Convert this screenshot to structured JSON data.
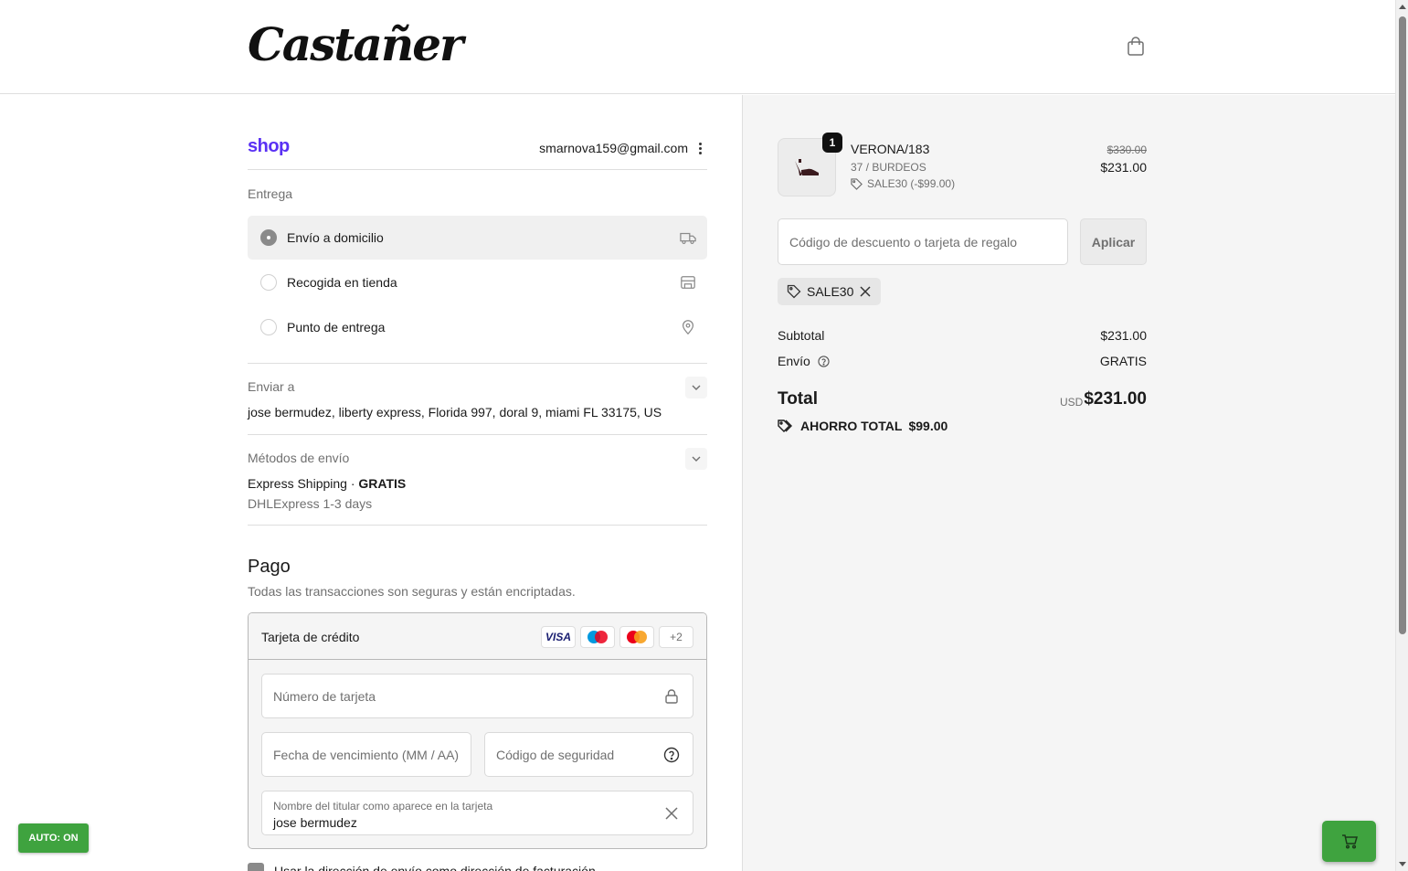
{
  "header": {
    "logo_text": "Castañer",
    "cart_icon": "shopping-bag-icon"
  },
  "account": {
    "shop_logo": "shop",
    "email": "smarnova159@gmail.com",
    "menu_icon": "kebab-icon"
  },
  "delivery": {
    "label": "Entrega",
    "options": [
      {
        "label": "Envío a domicilio",
        "icon": "truck-icon",
        "selected": true
      },
      {
        "label": "Recogida en tienda",
        "icon": "store-icon",
        "selected": false
      },
      {
        "label": "Punto de entrega",
        "icon": "location-pin-icon",
        "selected": false
      }
    ]
  },
  "ship_to": {
    "label": "Enviar a",
    "address": "jose bermudez, liberty express, Florida 997, doral 9, miami FL 33175, US"
  },
  "shipping_method": {
    "label": "Métodos de envío",
    "name": "Express Shipping · ",
    "price": "GRATIS",
    "carrier": "DHLExpress 1-3 days"
  },
  "payment": {
    "title": "Pago",
    "subtitle": "Todas las transacciones son seguras y están encriptadas.",
    "method_label": "Tarjeta de crédito",
    "brands": [
      "VISA",
      "maestro",
      "mastercard",
      "+2"
    ],
    "card_number_placeholder": "Número de tarjeta",
    "expiry_placeholder": "Fecha de vencimiento (MM / AA)",
    "cvv_placeholder": "Código de seguridad",
    "name_label": "Nombre del titular como aparece en la tarjeta",
    "name_value": "jose bermudez",
    "billing_label": "Usar la dirección de envío como dirección de facturación"
  },
  "order": {
    "item": {
      "name": "VERONA/183",
      "variant": "37 / BURDEOS",
      "discount": "SALE30 (-$99.00)",
      "quantity": "1",
      "original_price": "$330.00",
      "price": "$231.00"
    },
    "discount_placeholder": "Código de descuento o tarjeta de regalo",
    "apply_label": "Aplicar",
    "applied_code": "SALE30",
    "subtotal_label": "Subtotal",
    "subtotal_value": "$231.00",
    "shipping_label": "Envío",
    "shipping_value": "GRATIS",
    "total_label": "Total",
    "currency": "USD",
    "total_value": "$231.00",
    "savings_label": "AHORRO TOTAL",
    "savings_value": "$99.00"
  },
  "overlay": {
    "auto_label": "AUTO: ON",
    "cart_fab_icon": "cart-icon"
  }
}
